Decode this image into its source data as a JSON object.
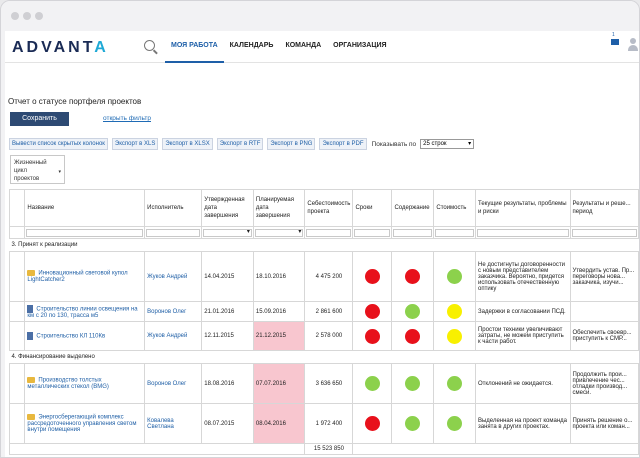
{
  "app": {
    "logo_a": "ADVANT",
    "logo_b": "A"
  },
  "nav": {
    "items": [
      "МОЯ РАБОТА",
      "КАЛЕНДАРЬ",
      "КОМАНДА",
      "ОРГАНИЗАЦИЯ"
    ],
    "active": "МОЯ РАБОТА",
    "badge": "1"
  },
  "page": {
    "title": "Отчет о статусе портфеля проектов",
    "save_label": "Сохранить",
    "filter_link": "открыть фильтр"
  },
  "exports": {
    "buttons": [
      "Вывести список скрытых колонок",
      "Экспорт в XLS",
      "Экспорт в XLSX",
      "Экспорт в RTF",
      "Экспорт в PNG",
      "Экспорт в PDF"
    ],
    "show_label": "Показывать по",
    "page_size": "25 строк"
  },
  "lifecycle": {
    "line1": "Жизненный",
    "line2": "цикл",
    "line3": "проектов"
  },
  "table": {
    "headers": [
      "Название",
      "Исполнитель",
      "Утвержденная дата завершения",
      "Планируемая дата завершения",
      "Себестоимость проекта",
      "Сроки",
      "Содержание",
      "Стоимость",
      "Текущие результаты, проблемы и риски",
      "Результаты и реше... период"
    ],
    "groups": [
      {
        "label": "3. Принят к реализации",
        "rows": [
          {
            "icon": "folder",
            "name": "Инновационный световой купол LightCatcher2",
            "owner": "Жуков Андрей",
            "approved": "14.04.2015",
            "planned": "18.10.2016",
            "planned_late": false,
            "cost": "4 475 200",
            "s1": "red",
            "s2": "red",
            "s3": "green",
            "results": "Не достигнуты договоренности с новым представителем заказчика. Вероятно, придется использовать отечественную оптику",
            "period": "Утвердить устав. Пр... переговоры нова... заказчика, изучи..."
          },
          {
            "icon": "doc",
            "name": "Строительство линии освещения на км с 20 по 130, трасса м5",
            "owner": "Воронов Олег",
            "approved": "21.01.2016",
            "planned": "15.09.2016",
            "planned_late": false,
            "cost": "2 861 600",
            "s1": "red",
            "s2": "green",
            "s3": "yellow",
            "results": "Задержки в согласовании ПСД.",
            "period": ""
          },
          {
            "icon": "doc",
            "name": "Строительство КЛ 110Кв",
            "owner": "Жуков Андрей",
            "approved": "12.11.2015",
            "planned": "21.12.2015",
            "planned_late": true,
            "cost": "2 578 000",
            "s1": "red",
            "s2": "red",
            "s3": "yellow",
            "results": "Простои техники увеличивают затраты, не можем приступить к части работ.",
            "period": "Обеспечить своевр... приступить к СМР..."
          }
        ]
      },
      {
        "label": "4. Финансирование выделено",
        "rows": [
          {
            "icon": "folder",
            "name": "Производство толстых металлических стекол (BMG)",
            "owner": "Воронов Олег",
            "approved": "18.08.2016",
            "planned": "07.07.2016",
            "planned_late": true,
            "cost": "3 636 650",
            "s1": "green",
            "s2": "green",
            "s3": "green",
            "results": "Отклонений не ожидается.",
            "period": "Продолжить прои... привлечение чес... отладки производ... смеси."
          },
          {
            "icon": "folder",
            "name": "Энергосберегающий комплекс рассредоточенного управления светом внутри помещения",
            "owner": "Ковалева Светлана",
            "approved": "08.07.2015",
            "planned": "08.04.2016",
            "planned_late": true,
            "cost": "1 972 400",
            "s1": "red",
            "s2": "green",
            "s3": "green",
            "results": "Выделенная на проект команда занята в других проектах.",
            "period": "Принять решение о... проекта или коман..."
          }
        ]
      }
    ],
    "total": "15 523 850"
  },
  "colors": {
    "red": "#e8111b",
    "green": "#8cd14c",
    "yellow": "#f8f000",
    "late": "#f8c6cf",
    "primary": "#2d4a73"
  }
}
